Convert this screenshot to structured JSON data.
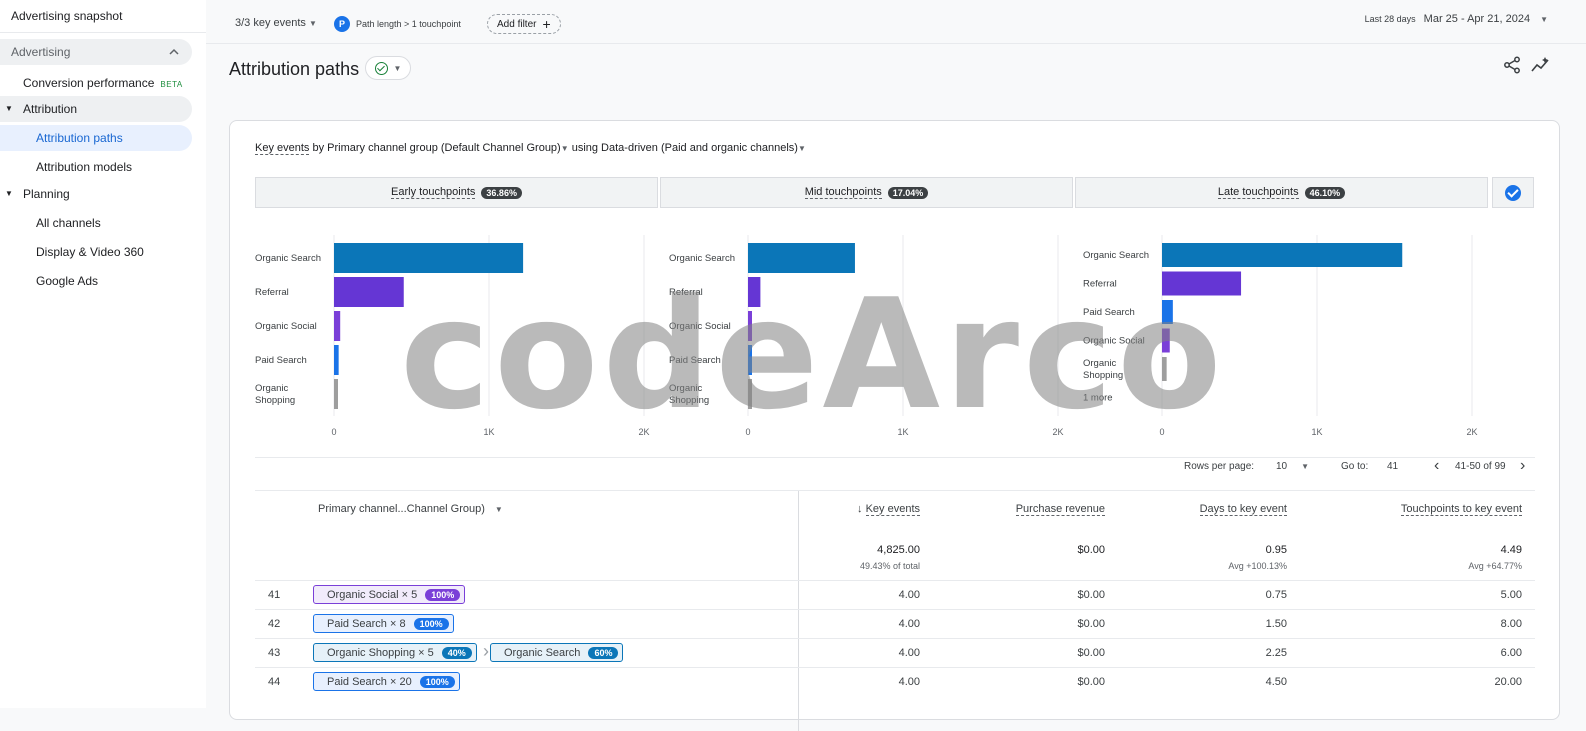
{
  "sidebar": {
    "title": "Advertising snapshot",
    "section": "Advertising",
    "conversion_performance": "Conversion performance",
    "beta": "BETA",
    "attribution": "Attribution",
    "attribution_paths": "Attribution paths",
    "attribution_models": "Attribution models",
    "planning": "Planning",
    "all_channels": "All channels",
    "display_video": "Display & Video 360",
    "google_ads": "Google Ads"
  },
  "topbar": {
    "key_events": "3/3 key events",
    "path_filter_badge": "P",
    "path_filter": "Path length > 1 touchpoint",
    "add_filter": "Add filter",
    "last_days": "Last 28 days",
    "date_range": "Mar 25 - Apr 21, 2024"
  },
  "page": {
    "title": "Attribution paths"
  },
  "card": {
    "sub_key_events": "Key events",
    "sub_by": " by Primary channel group (Default Channel Group)",
    "sub_using": " using Data-driven (Paid and organic channels)"
  },
  "stages": [
    {
      "label": "Early touchpoints",
      "pct": "36.86%"
    },
    {
      "label": "Mid touchpoints",
      "pct": "17.04%"
    },
    {
      "label": "Late touchpoints",
      "pct": "46.10%"
    }
  ],
  "chart_data": [
    {
      "type": "bar",
      "orientation": "horizontal",
      "categories": [
        "Organic Search",
        "Referral",
        "Organic Social",
        "Paid Search",
        "Organic Shopping"
      ],
      "values": [
        1220,
        450,
        40,
        30,
        25
      ],
      "xlim": [
        0,
        2000
      ],
      "ticks": [
        "0",
        "1K",
        "2K"
      ]
    },
    {
      "type": "bar",
      "orientation": "horizontal",
      "categories": [
        "Organic Search",
        "Referral",
        "Organic Social",
        "Paid Search",
        "Organic Shopping"
      ],
      "values": [
        690,
        80,
        25,
        20,
        15
      ],
      "xlim": [
        0,
        2000
      ],
      "ticks": [
        "0",
        "1K",
        "2K"
      ]
    },
    {
      "type": "bar",
      "orientation": "horizontal",
      "categories": [
        "Organic Search",
        "Referral",
        "Paid Search",
        "Organic Social",
        "Organic Shopping",
        "1 more"
      ],
      "values": [
        1550,
        510,
        70,
        50,
        30,
        0
      ],
      "xlim": [
        0,
        2000
      ],
      "ticks": [
        "0",
        "1K",
        "2K"
      ]
    }
  ],
  "colors": {
    "organic_search": "#0b76b8",
    "referral": "#6536d4",
    "organic_social": "#7a3fd8",
    "paid_search": "#1a73e8",
    "organic_shopping": "#9e9e9e"
  },
  "pagination": {
    "rows_per_page_label": "Rows per page:",
    "rows_per_page": "10",
    "goto_label": "Go to:",
    "goto_value": "41",
    "range": "41-50 of 99"
  },
  "table": {
    "dim_header": "Primary channel...Channel Group)",
    "col_key_events": "Key events",
    "col_revenue": "Purchase revenue",
    "col_days": "Days to key event",
    "col_touchpoints": "Touchpoints to key event",
    "totals": {
      "key_events": "4,825.00",
      "key_events_sub": "49.43% of total",
      "revenue": "$0.00",
      "days": "0.95",
      "days_sub": "Avg +100.13%",
      "touchpoints": "4.49",
      "touchpoints_sub": "Avg +64.77%"
    },
    "rows": [
      {
        "num": "41",
        "path1": "Organic Social × 5",
        "pct1": "100%",
        "key_events": "4.00",
        "revenue": "$0.00",
        "days": "0.75",
        "touchpoints": "5.00"
      },
      {
        "num": "42",
        "path1": "Paid Search × 8",
        "pct1": "100%",
        "key_events": "4.00",
        "revenue": "$0.00",
        "days": "1.50",
        "touchpoints": "8.00"
      },
      {
        "num": "43",
        "path1": "Organic Shopping × 5",
        "pct1": "40%",
        "path2": "Organic Search",
        "pct2": "60%",
        "key_events": "4.00",
        "revenue": "$0.00",
        "days": "2.25",
        "touchpoints": "6.00"
      },
      {
        "num": "44",
        "path1": "Paid Search × 20",
        "pct1": "100%",
        "key_events": "4.00",
        "revenue": "$0.00",
        "days": "4.50",
        "touchpoints": "20.00"
      }
    ]
  },
  "watermark": "codeArco"
}
